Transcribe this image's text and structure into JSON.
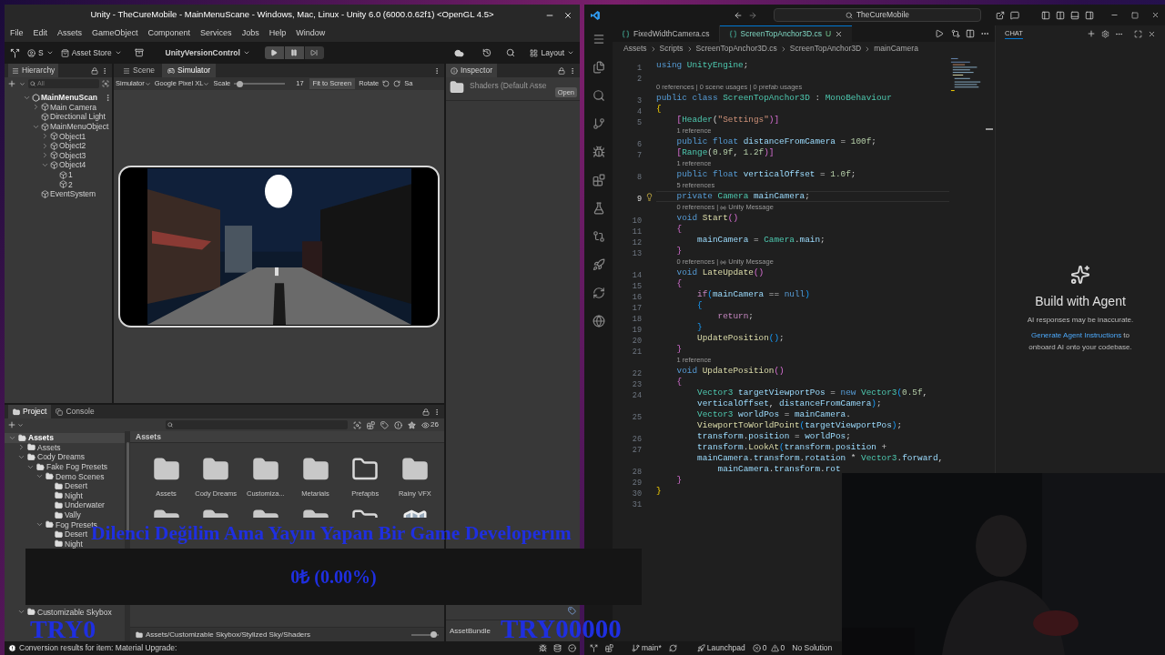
{
  "unity": {
    "title": "Unity - TheCureMobile - MainMenuScane - Windows, Mac, Linux - Unity 6.0 (6000.0.62f1) <OpenGL 4.5>",
    "menu": [
      "File",
      "Edit",
      "Assets",
      "GameObject",
      "Component",
      "Services",
      "Jobs",
      "Help",
      "Window"
    ],
    "toolbar": {
      "account": "S",
      "asset_store": "Asset Store",
      "version_control": "UnityVersionControl",
      "layout": "Layout"
    },
    "hierarchy": {
      "tab": "Hierarchy",
      "search_placeholder": "All",
      "tree": [
        {
          "label": "MainMenuScan",
          "kind": "scene",
          "expanded": true,
          "children": [
            {
              "label": "Main Camera",
              "expanded": false
            },
            {
              "label": "Directional Light"
            },
            {
              "label": "MainMenuObject",
              "expanded": true,
              "children": [
                {
                  "label": "Object1",
                  "expanded": false
                },
                {
                  "label": "Object2",
                  "expanded": false
                },
                {
                  "label": "Object3",
                  "expanded": false
                },
                {
                  "label": "Object4",
                  "expanded": true,
                  "children": [
                    {
                      "label": "1"
                    },
                    {
                      "label": "2"
                    }
                  ]
                }
              ]
            },
            {
              "label": "EventSystem"
            }
          ]
        }
      ]
    },
    "scene_tabs": [
      {
        "label": "Scene",
        "selected": false
      },
      {
        "label": "Simulator",
        "selected": true
      }
    ],
    "simulator_bar": {
      "mode": "Simulator",
      "device": "Google Pixel XL",
      "scale_label": "Scale",
      "scale": {
        "level": 0.1
      },
      "scale_value": "17",
      "fit": "Fit to Screen",
      "rotate": "Rotate",
      "cut": "Sa"
    },
    "inspector": {
      "tab": "Inspector",
      "asset": "Shaders (Default Asse",
      "open": "Open",
      "asset_bundle": "AssetBundle"
    },
    "project": {
      "tabs": [
        {
          "label": "Project",
          "selected": true
        },
        {
          "label": "Console",
          "selected": false
        }
      ],
      "count": "26",
      "tree": [
        {
          "label": "Assets",
          "expanded": true,
          "children": [
            {
              "label": "Assets",
              "expanded": false
            },
            {
              "label": "Cody Dreams",
              "expanded": true,
              "children": [
                {
                  "label": "Fake Fog Presets",
                  "expanded": true,
                  "children": [
                    {
                      "label": "Demo Scenes",
                      "expanded": true,
                      "children": [
                        {
                          "label": "Desert"
                        },
                        {
                          "label": "Night"
                        },
                        {
                          "label": "Underwater"
                        },
                        {
                          "label": "Vally"
                        }
                      ]
                    },
                    {
                      "label": "Fog Presets",
                      "expanded": true,
                      "children": [
                        {
                          "label": "Desert"
                        },
                        {
                          "label": "Night"
                        }
                      ]
                    }
                  ]
                }
              ]
            },
            {
              "label": "Customizable Skybox",
              "expanded": true
            }
          ]
        }
      ],
      "grid_title": "Assets",
      "items": [
        {
          "kind": "folder",
          "label": "Assets"
        },
        {
          "kind": "folder",
          "label": "Cody Dreams"
        },
        {
          "kind": "folder",
          "label": "Customiza..."
        },
        {
          "kind": "folder",
          "label": "Metarials"
        },
        {
          "kind": "empty_folder",
          "label": "Prefapbs"
        },
        {
          "kind": "folder",
          "label": "Rainy VFX"
        },
        {
          "kind": "folder"
        },
        {
          "kind": "folder"
        },
        {
          "kind": "folder"
        },
        {
          "kind": "folder"
        },
        {
          "kind": "empty_folder"
        },
        {
          "kind": "asset"
        }
      ],
      "path": "Assets/Customizable Skybox/Stylized Sky/Shaders",
      "zoom": {
        "level": 0.8
      }
    },
    "status": "Conversion results for item: Material Upgrade:"
  },
  "vscode": {
    "search": "TheCureMobile",
    "tabs": [
      {
        "label": "FixedWidthCamera.cs",
        "selected": false
      },
      {
        "label": "ScreenTopAnchor3D.cs",
        "badge": "U",
        "selected": true
      }
    ],
    "breadcrumbs": [
      "Assets",
      "Scripts",
      "ScreenTopAnchor3D.cs",
      "ScreenTopAnchor3D",
      "mainCamera"
    ],
    "lines": [
      {
        "kind": "code",
        "n": "1",
        "selected": false,
        "segs": [
          {
            "kind": "keyword",
            "text": "using "
          },
          {
            "kind": "type",
            "text": "UnityEngine"
          },
          {
            "kind": "plain",
            "text": ";"
          }
        ]
      },
      {
        "kind": "code",
        "n": "2",
        "selected": false
      },
      {
        "kind": "lens",
        "text": "0 references | 0 scene usages | 0 prefab usages"
      },
      {
        "kind": "code",
        "n": "3",
        "selected": false,
        "segs": [
          {
            "kind": "keyword",
            "text": "public class "
          },
          {
            "kind": "type",
            "text": "ScreenTopAnchor3D"
          },
          {
            "kind": "plain",
            "text": " : "
          },
          {
            "kind": "type",
            "text": "MonoBehaviour"
          }
        ]
      },
      {
        "kind": "code",
        "n": "4",
        "selected": false,
        "segs": [
          {
            "kind": "brace",
            "text": "{"
          }
        ]
      },
      {
        "kind": "code",
        "n": "5",
        "selected": false,
        "segs": [
          {
            "kind": "bracket",
            "text": "    ["
          },
          {
            "kind": "type",
            "text": "Header"
          },
          {
            "kind": "plain",
            "text": "("
          },
          {
            "kind": "string",
            "text": "\"Settings\""
          },
          {
            "kind": "bracket",
            "text": ")]"
          }
        ]
      },
      {
        "kind": "lens",
        "text": "    1 reference"
      },
      {
        "kind": "code",
        "n": "6",
        "selected": false,
        "segs": [
          {
            "kind": "keyword",
            "text": "    public float "
          },
          {
            "kind": "name",
            "text": "distanceFromCamera"
          },
          {
            "kind": "plain",
            "text": " = "
          },
          {
            "kind": "number",
            "text": "100f"
          },
          {
            "kind": "plain",
            "text": ";"
          }
        ]
      },
      {
        "kind": "code",
        "n": "7",
        "selected": false,
        "segs": [
          {
            "kind": "bracket",
            "text": "    ["
          },
          {
            "kind": "type",
            "text": "Range"
          },
          {
            "kind": "plain",
            "text": "("
          },
          {
            "kind": "number",
            "text": "0.9f"
          },
          {
            "kind": "plain",
            "text": ", "
          },
          {
            "kind": "number",
            "text": "1.2f"
          },
          {
            "kind": "bracket",
            "text": ")]"
          }
        ]
      },
      {
        "kind": "lens",
        "text": "    1 reference"
      },
      {
        "kind": "code",
        "n": "8",
        "selected": false,
        "segs": [
          {
            "kind": "keyword",
            "text": "    public float "
          },
          {
            "kind": "name",
            "text": "verticalOffset"
          },
          {
            "kind": "plain",
            "text": " = "
          },
          {
            "kind": "number",
            "text": "1.0f"
          },
          {
            "kind": "plain",
            "text": ";"
          }
        ]
      },
      {
        "kind": "lens",
        "text": "    5 references"
      },
      {
        "kind": "code",
        "n": "9",
        "selected": true,
        "segs": [
          {
            "kind": "keyword",
            "text": "    private "
          },
          {
            "kind": "type",
            "text": "Camera "
          },
          {
            "kind": "name",
            "text": "mainCamera"
          },
          {
            "kind": "plain",
            "text": ";"
          }
        ]
      },
      {
        "kind": "lens",
        "text": "    0 references |",
        "message": "Unity Message"
      },
      {
        "kind": "code",
        "n": "10",
        "selected": false,
        "segs": [
          {
            "kind": "keyword",
            "text": "    void "
          },
          {
            "kind": "method",
            "text": "Start"
          },
          {
            "kind": "bracket",
            "text": "()"
          }
        ]
      },
      {
        "kind": "code",
        "n": "11",
        "selected": false,
        "segs": [
          {
            "kind": "bracket",
            "text": "    {"
          }
        ]
      },
      {
        "kind": "code",
        "n": "12",
        "selected": false,
        "segs": [
          {
            "kind": "name",
            "text": "        mainCamera"
          },
          {
            "kind": "plain",
            "text": " = "
          },
          {
            "kind": "type",
            "text": "Camera"
          },
          {
            "kind": "plain",
            "text": "."
          },
          {
            "kind": "name",
            "text": "main"
          },
          {
            "kind": "plain",
            "text": ";"
          }
        ]
      },
      {
        "kind": "code",
        "n": "13",
        "selected": false,
        "segs": [
          {
            "kind": "bracket",
            "text": "    }"
          }
        ]
      },
      {
        "kind": "lens",
        "text": "    0 references |",
        "message": "Unity Message"
      },
      {
        "kind": "code",
        "n": "14",
        "selected": false,
        "segs": [
          {
            "kind": "keyword",
            "text": "    void "
          },
          {
            "kind": "method",
            "text": "LateUpdate"
          },
          {
            "kind": "bracket",
            "text": "()"
          }
        ]
      },
      {
        "kind": "code",
        "n": "15",
        "selected": false,
        "segs": [
          {
            "kind": "bracket",
            "text": "    {"
          }
        ]
      },
      {
        "kind": "code",
        "n": "16",
        "selected": false,
        "segs": [
          {
            "kind": "control",
            "text": "        if"
          },
          {
            "kind": "paren",
            "text": "("
          },
          {
            "kind": "name",
            "text": "mainCamera"
          },
          {
            "kind": "plain",
            "text": " == "
          },
          {
            "kind": "keyword",
            "text": "null"
          },
          {
            "kind": "paren",
            "text": ")"
          }
        ]
      },
      {
        "kind": "code",
        "n": "17",
        "selected": false,
        "segs": [
          {
            "kind": "paren",
            "text": "        {"
          }
        ]
      },
      {
        "kind": "code",
        "n": "18",
        "selected": false,
        "segs": [
          {
            "kind": "control",
            "text": "            return"
          },
          {
            "kind": "plain",
            "text": ";"
          }
        ]
      },
      {
        "kind": "code",
        "n": "19",
        "selected": false,
        "segs": [
          {
            "kind": "paren",
            "text": "        }"
          }
        ]
      },
      {
        "kind": "code",
        "n": "20",
        "selected": false,
        "segs": [
          {
            "kind": "method",
            "text": "        UpdatePosition"
          },
          {
            "kind": "paren",
            "text": "()"
          },
          {
            "kind": "plain",
            "text": ";"
          }
        ]
      },
      {
        "kind": "code",
        "n": "21",
        "selected": false,
        "segs": [
          {
            "kind": "bracket",
            "text": "    }"
          }
        ]
      },
      {
        "kind": "lens",
        "text": "    1 reference"
      },
      {
        "kind": "code",
        "n": "22",
        "selected": false,
        "segs": [
          {
            "kind": "keyword",
            "text": "    void "
          },
          {
            "kind": "method",
            "text": "UpdatePosition"
          },
          {
            "kind": "bracket",
            "text": "()"
          }
        ]
      },
      {
        "kind": "code",
        "n": "23",
        "selected": false,
        "segs": [
          {
            "kind": "bracket",
            "text": "    {"
          }
        ]
      },
      {
        "kind": "code",
        "n": "24",
        "selected": false,
        "segs": [
          {
            "kind": "type",
            "text": "        Vector3 "
          },
          {
            "kind": "name",
            "text": "targetViewportPos"
          },
          {
            "kind": "plain",
            "text": " = "
          },
          {
            "kind": "keyword",
            "text": "new "
          },
          {
            "kind": "type",
            "text": "Vector3"
          },
          {
            "kind": "paren",
            "text": "("
          },
          {
            "kind": "number",
            "text": "0.5f"
          },
          {
            "kind": "plain",
            "text": ","
          }
        ]
      },
      {
        "kind": "code",
        "selected": false,
        "segs": [
          {
            "kind": "name",
            "text": "        verticalOffset"
          },
          {
            "kind": "plain",
            "text": ", "
          },
          {
            "kind": "name",
            "text": "distanceFromCamera"
          },
          {
            "kind": "paren",
            "text": ")"
          },
          {
            "kind": "plain",
            "text": ";"
          }
        ]
      },
      {
        "kind": "code",
        "n": "25",
        "selected": false,
        "segs": [
          {
            "kind": "type",
            "text": "        Vector3 "
          },
          {
            "kind": "name",
            "text": "worldPos"
          },
          {
            "kind": "plain",
            "text": " = "
          },
          {
            "kind": "name",
            "text": "mainCamera"
          },
          {
            "kind": "plain",
            "text": "."
          }
        ]
      },
      {
        "kind": "code",
        "selected": false,
        "segs": [
          {
            "kind": "method",
            "text": "        ViewportToWorldPoint"
          },
          {
            "kind": "paren",
            "text": "("
          },
          {
            "kind": "name",
            "text": "targetViewportPos"
          },
          {
            "kind": "paren",
            "text": ")"
          },
          {
            "kind": "plain",
            "text": ";"
          }
        ]
      },
      {
        "kind": "code",
        "n": "26",
        "selected": false,
        "segs": [
          {
            "kind": "name",
            "text": "        transform"
          },
          {
            "kind": "plain",
            "text": "."
          },
          {
            "kind": "name",
            "text": "position"
          },
          {
            "kind": "plain",
            "text": " = "
          },
          {
            "kind": "name",
            "text": "worldPos"
          },
          {
            "kind": "plain",
            "text": ";"
          }
        ]
      },
      {
        "kind": "code",
        "n": "27",
        "selected": false,
        "segs": [
          {
            "kind": "name",
            "text": "        transform"
          },
          {
            "kind": "plain",
            "text": "."
          },
          {
            "kind": "method",
            "text": "LookAt"
          },
          {
            "kind": "paren",
            "text": "("
          },
          {
            "kind": "name",
            "text": "transform"
          },
          {
            "kind": "plain",
            "text": "."
          },
          {
            "kind": "name",
            "text": "position"
          },
          {
            "kind": "plain",
            "text": " +"
          }
        ]
      },
      {
        "kind": "code",
        "selected": false,
        "segs": [
          {
            "kind": "name",
            "text": "        mainCamera"
          },
          {
            "kind": "plain",
            "text": "."
          },
          {
            "kind": "name",
            "text": "transform"
          },
          {
            "kind": "plain",
            "text": "."
          },
          {
            "kind": "name",
            "text": "rotation"
          },
          {
            "kind": "plain",
            "text": " * "
          },
          {
            "kind": "type",
            "text": "Vector3"
          },
          {
            "kind": "plain",
            "text": "."
          },
          {
            "kind": "name",
            "text": "forward"
          },
          {
            "kind": "plain",
            "text": ","
          }
        ]
      },
      {
        "kind": "code",
        "n": "28",
        "selected": false,
        "segs": [
          {
            "kind": "name",
            "text": "            mainCamera"
          },
          {
            "kind": "plain",
            "text": "."
          },
          {
            "kind": "name",
            "text": "transform"
          },
          {
            "kind": "plain",
            "text": "."
          },
          {
            "kind": "name",
            "text": "rot"
          }
        ]
      },
      {
        "kind": "code",
        "n": "29",
        "selected": false,
        "segs": [
          {
            "kind": "bracket",
            "text": "    }"
          }
        ]
      },
      {
        "kind": "code",
        "n": "30",
        "selected": false,
        "segs": [
          {
            "kind": "brace",
            "text": "}"
          }
        ]
      },
      {
        "kind": "code",
        "n": "31",
        "selected": false
      }
    ],
    "chat": {
      "title": "CHAT",
      "heading": "Build with Agent",
      "note": "AI responses may be inaccurate.",
      "link": "Generate Agent Instructions",
      "after_link": " to onboard AI onto your codebase."
    },
    "status": {
      "branch": "main*",
      "launchpad": "Launchpad",
      "errors": "0",
      "warnings": "0",
      "solution": "No Solution"
    }
  },
  "stream_overlay": {
    "title": "Dilenci Değilim Ama Yayın Yapan Bir Game Developerım",
    "amount": "0₺ (0.00%)",
    "goal_left": "TRY0",
    "goal_right": "TRY00000"
  }
}
